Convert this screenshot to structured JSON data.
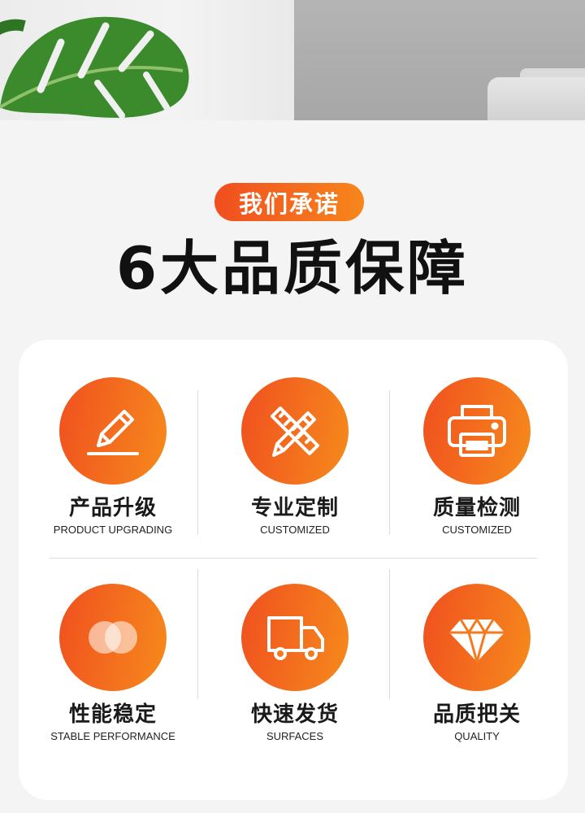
{
  "banner": {
    "leaf_icon": "monstera-leaf"
  },
  "header": {
    "pill_label": "我们承诺",
    "title": "6大品质保障"
  },
  "colors": {
    "accent_start": "#f04e1f",
    "accent_end": "#f7861b",
    "background": "#f4f4f4",
    "card": "#ffffff"
  },
  "features": [
    {
      "title": "产品升级",
      "subtitle": "PRODUCT UPGRADING",
      "icon": "pencil-icon"
    },
    {
      "title": "专业定制",
      "subtitle": "CUSTOMIZED",
      "icon": "pencil-ruler-icon"
    },
    {
      "title": "质量检测",
      "subtitle": "CUSTOMIZED",
      "icon": "printer-icon"
    },
    {
      "title": "性能稳定",
      "subtitle": "STABLE PERFORMANCE",
      "icon": "overlapping-circles-icon"
    },
    {
      "title": "快速发货",
      "subtitle": "SURFACES",
      "icon": "truck-icon"
    },
    {
      "title": "品质把关",
      "subtitle": "QUALITY",
      "icon": "diamond-icon"
    }
  ]
}
